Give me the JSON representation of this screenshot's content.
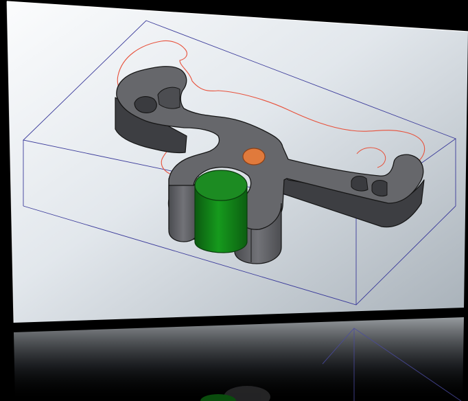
{
  "scene": {
    "description_visible_text": "",
    "colors": {
      "background": "#000000",
      "panel_light": "#f4f6f8",
      "panel_dark": "#aeb6bd",
      "bounding_box_edge": "#3a3a9a",
      "part_body": "#5f6064",
      "part_top": "#6c6d71",
      "part_edge": "#1c1c1c",
      "cylinder_fill": "#117a17",
      "cylinder_top": "#1f8f25",
      "pin_orange": "#e07a3c",
      "projection_outline": "#e8503a"
    }
  }
}
